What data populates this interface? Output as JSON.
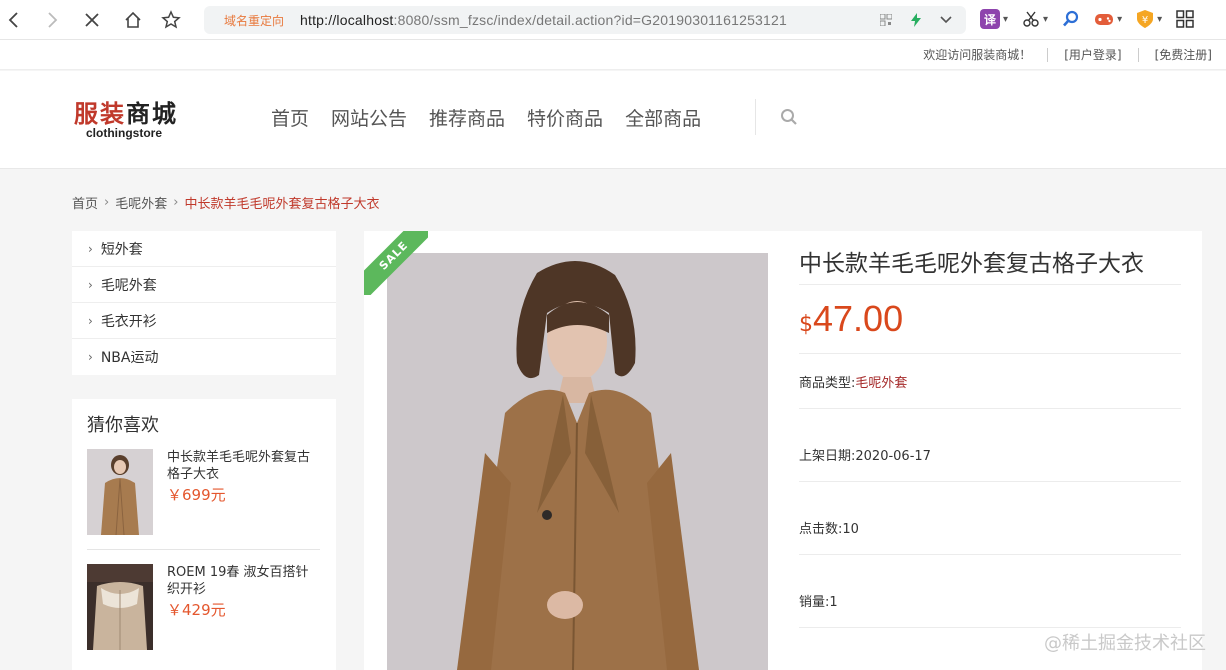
{
  "browser": {
    "redirect_tag": "域名重定向",
    "url_host": "http://localhost",
    "url_rest": ":8080/ssm_fzsc/index/detail.action?id=G20190301161253121",
    "translate_label": "译"
  },
  "top_links": {
    "welcome": "欢迎访问服装商城！",
    "login": "[用户登录]",
    "register": "[免费注册]"
  },
  "logo": {
    "cn_part1": "服装",
    "cn_part2": "商城",
    "en": "clothingstore"
  },
  "nav": {
    "items": [
      "首页",
      "网站公告",
      "推荐商品",
      "特价商品",
      "全部商品"
    ]
  },
  "breadcrumb": {
    "home": "首页",
    "category": "毛呢外套",
    "current": "中长款羊毛毛呢外套复古格子大衣"
  },
  "categories": [
    "短外套",
    "毛呢外套",
    "毛衣开衫",
    "NBA运动"
  ],
  "guess": {
    "title": "猜你喜欢",
    "items": [
      {
        "name": "中长款羊毛毛呢外套复古格子大衣",
        "price": "￥699元"
      },
      {
        "name": "ROEM 19春 淑女百搭针织开衫",
        "price": "￥429元"
      }
    ]
  },
  "product": {
    "sale_badge": "SALE",
    "title": "中长款羊毛毛呢外套复古格子大衣",
    "currency": "$",
    "price": "47.00",
    "type_label": "商品类型:",
    "type_value": "毛呢外套",
    "date_label": "上架日期:",
    "date_value": "2020-06-17",
    "clicks_label": "点击数:",
    "clicks_value": "10",
    "sales_label": "销量:",
    "sales_value": "1"
  },
  "watermark": "@稀土掘金技术社区",
  "colors": {
    "accent_red": "#c0392b",
    "price_orange": "#d9481c",
    "sale_green": "#5cb85c"
  }
}
